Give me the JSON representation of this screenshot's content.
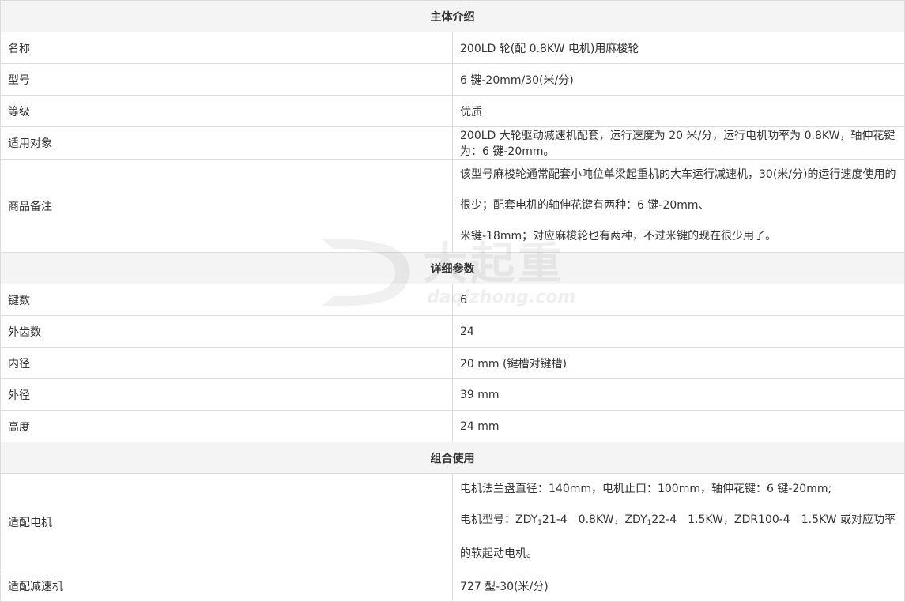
{
  "sections": {
    "intro": "主体介绍",
    "details": "详细参数",
    "combo": "组合使用"
  },
  "intro_rows": [
    {
      "label": "名称",
      "value": "200LD 轮(配 0.8KW 电机)用麻梭轮"
    },
    {
      "label": "型号",
      "value": "6 键-20mm/30(米/分)"
    },
    {
      "label": "等级",
      "value": "优质"
    },
    {
      "label": "适用对象",
      "value": "200LD 大轮驱动减速机配套，运行速度为 20 米/分，运行电机功率为 0.8KW，轴伸花键为：6 键-20mm。"
    },
    {
      "label": "商品备注",
      "value_line1": "该型号麻梭轮通常配套小吨位单梁起重机的大车运行减速机，30(米/分)的运行速度使用的很少；配套电机的轴伸花键有两种：6  键-20mm、",
      "value_line2": "米键-18mm；对应麻梭轮也有两种，不过米键的现在很少用了。"
    }
  ],
  "detail_rows": [
    {
      "label": "键数",
      "value": "6"
    },
    {
      "label": "外齿数",
      "value": "24"
    },
    {
      "label": "内径",
      "value": "20 mm (键槽对键槽)"
    },
    {
      "label": "外径",
      "value": "39 mm"
    },
    {
      "label": "高度",
      "value": "24 mm"
    }
  ],
  "combo_rows": {
    "motor": {
      "label": "适配电机",
      "line1": "电机法兰盘直径：140mm，电机止口：100mm，轴伸花键：6 键-20mm;",
      "line2_a": "电机型号：ZDY",
      "line2_sub1": "1",
      "line2_b": "21-4　0.8KW，ZDY",
      "line2_sub2": "1",
      "line2_c": "22-4　1.5KW，ZDR100-4　1.5KW 或对应功率的软起动电机。"
    },
    "reducer": {
      "label": "适配减速机",
      "value": "727 型-30(米/分)"
    }
  },
  "watermark": {
    "cn": "大起重",
    "en": "daqizhong.com"
  }
}
